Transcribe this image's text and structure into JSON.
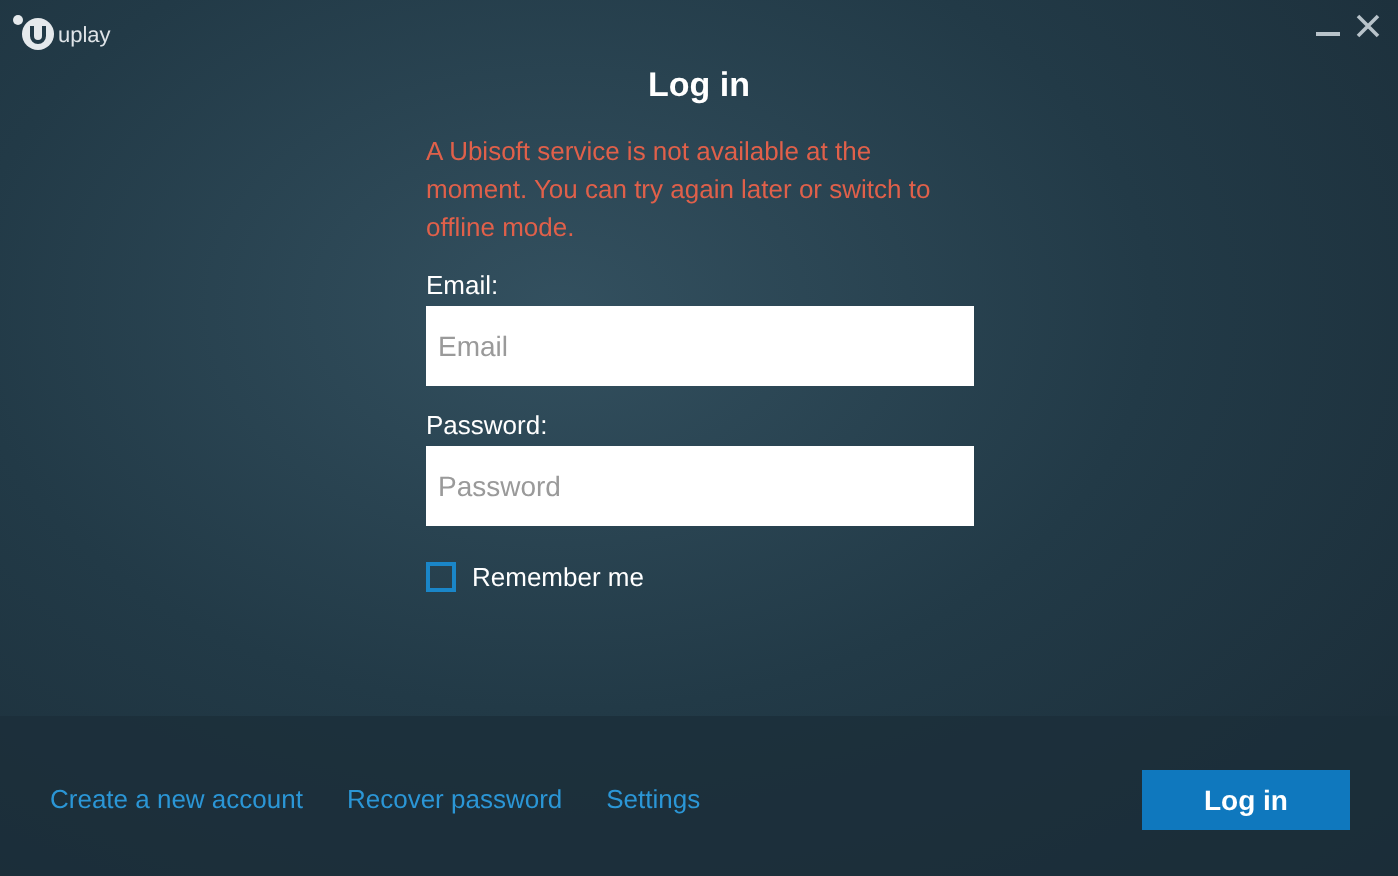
{
  "logo": {
    "text": "uplay"
  },
  "title": "Log in",
  "error": "A Ubisoft service is not available at the moment. You can try again later or switch to offline mode.",
  "fields": [
    {
      "label": "Email:",
      "placeholder": "Email"
    },
    {
      "label": "Password:",
      "placeholder": "Password"
    }
  ],
  "remember": {
    "label": "Remember me",
    "checked": false
  },
  "links": [
    "Create a new account",
    "Recover password",
    "Settings"
  ],
  "login_button": "Log in"
}
